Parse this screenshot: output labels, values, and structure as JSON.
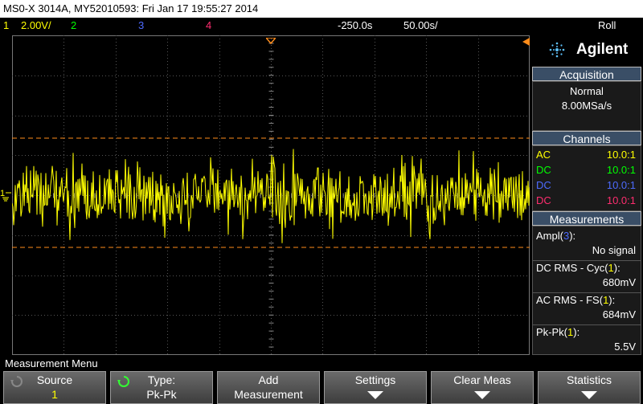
{
  "title": "MS0-X 3014A, MY52010593: Fri Jan 17 19:55:27 2014",
  "status": {
    "ch1_num": "1",
    "ch1_scale": "2.00V/",
    "ch2_num": "2",
    "ch3_num": "3",
    "ch4_num": "4",
    "delay": "-250.0s",
    "timebase": "50.00s/",
    "mode": "Roll"
  },
  "panel": {
    "brand": "Agilent",
    "acquisition": {
      "header": "Acquisition",
      "mode": "Normal",
      "rate": "8.00MSa/s"
    },
    "channels": {
      "header": "Channels",
      "rows": [
        {
          "coupling": "AC",
          "probe": "10.0:1",
          "color": "#ffff00"
        },
        {
          "coupling": "DC",
          "probe": "10.0:1",
          "color": "#00ff00"
        },
        {
          "coupling": "DC",
          "probe": "10.0:1",
          "color": "#4d6bff"
        },
        {
          "coupling": "DC",
          "probe": "10.0:1",
          "color": "#ff2d6f"
        }
      ]
    },
    "measurements": {
      "header": "Measurements",
      "items": [
        {
          "name": "Ampl(",
          "src": "3",
          "close": "):",
          "value": "No signal"
        },
        {
          "name": "DC RMS - Cyc(",
          "src": "1",
          "close": "):",
          "value": "680mV"
        },
        {
          "name": "AC RMS - FS(",
          "src": "1",
          "close": "):",
          "value": "684mV"
        },
        {
          "name": "Pk-Pk(",
          "src": "1",
          "close": "):",
          "value": "5.5V"
        }
      ]
    }
  },
  "menu": {
    "label": "Measurement Menu",
    "keys": [
      {
        "line1": "Source",
        "line2": "1"
      },
      {
        "line1": "Type:",
        "line2": "Pk-Pk"
      },
      {
        "line1": "Add",
        "line2": "Measurement"
      },
      {
        "line1": "Settings",
        "line2": ""
      },
      {
        "line1": "Clear Meas",
        "line2": ""
      },
      {
        "line1": "Statistics",
        "line2": ""
      }
    ]
  },
  "colors": {
    "trace": "#ffff00",
    "cursor": "#ff8c1a",
    "grid": "#555555",
    "panel_header": "#3a4e66"
  },
  "icons": {
    "ground": "ground-icon",
    "trigger": "trigger-marker-icon",
    "rotate": "rotate-arrow-icon"
  }
}
